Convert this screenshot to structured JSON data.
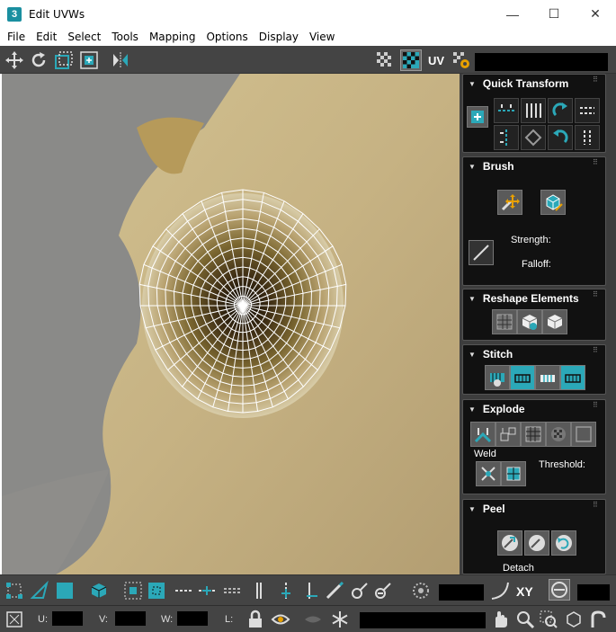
{
  "window": {
    "app_icon_text": "3",
    "title": "Edit UVWs",
    "minimize_glyph": "—",
    "maximize_glyph": "☐",
    "close_glyph": "✕"
  },
  "menu": [
    "File",
    "Edit",
    "Select",
    "Tools",
    "Mapping",
    "Options",
    "Display",
    "View"
  ],
  "toolbar_top": {
    "uv_label": "UV",
    "icons": [
      "move-icon",
      "rotate-icon",
      "scale-icon",
      "freeform-icon",
      "mirror-icon",
      "checker-pattern-icon",
      "checker-texture-icon",
      "uv-options-icon"
    ]
  },
  "rollouts": {
    "quick_transform": {
      "title": "Quick Transform"
    },
    "brush": {
      "title": "Brush",
      "strength_label": "Strength:",
      "falloff_label": "Falloff:"
    },
    "reshape": {
      "title": "Reshape Elements"
    },
    "stitch": {
      "title": "Stitch"
    },
    "explode": {
      "title": "Explode",
      "weld_label": "Weld",
      "threshold_label": "Threshold:"
    },
    "peel": {
      "title": "Peel",
      "detach_label": "Detach"
    }
  },
  "toolbar_bottom": {
    "xy_label": "XY",
    "u_label": "U:",
    "v_label": "V:",
    "w_label": "W:",
    "l_label": "L:"
  },
  "colors": {
    "accent": "#2ba8b8",
    "panel_bg": "#3d3d3d",
    "rollout_bg": "#111111",
    "mesh": "#ffffff"
  }
}
